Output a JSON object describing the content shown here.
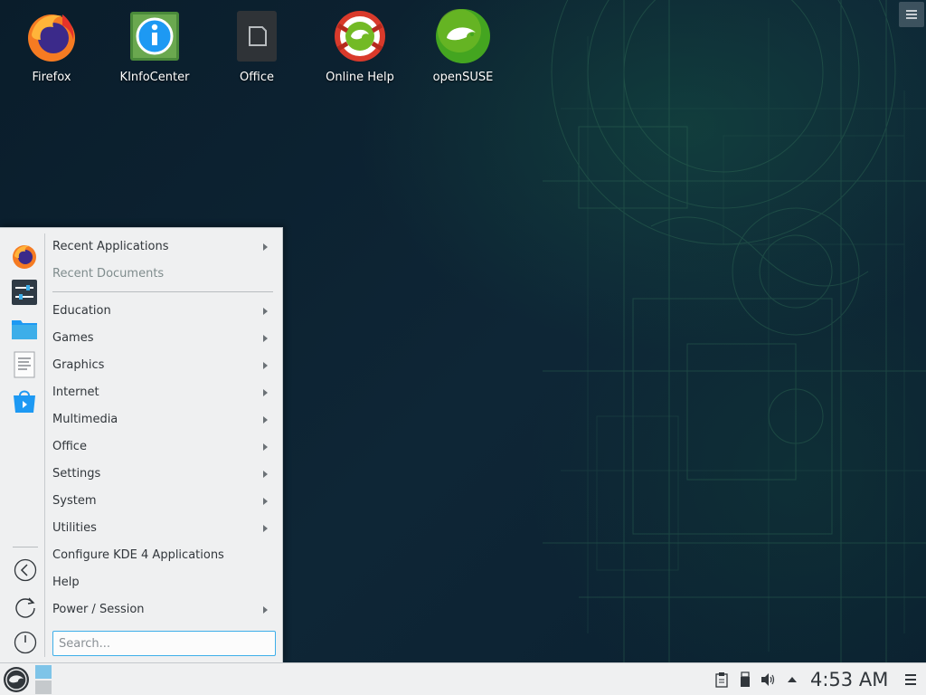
{
  "desktop": {
    "icons": [
      {
        "label": "Firefox",
        "icon": "firefox-icon"
      },
      {
        "label": "KInfoCenter",
        "icon": "kinfocenter-icon"
      },
      {
        "label": "Office",
        "icon": "office-icon"
      },
      {
        "label": "Online Help",
        "icon": "online-help-icon"
      },
      {
        "label": "openSUSE",
        "icon": "opensuse-icon"
      }
    ]
  },
  "menu": {
    "favorites": [
      {
        "icon": "firefox-icon"
      },
      {
        "icon": "system-settings-icon"
      },
      {
        "icon": "folder-icon"
      },
      {
        "icon": "text-editor-icon"
      },
      {
        "icon": "software-center-icon"
      }
    ],
    "controls": [
      {
        "icon": "back-icon"
      },
      {
        "icon": "refresh-icon"
      },
      {
        "icon": "power-icon"
      }
    ],
    "items": [
      {
        "label": "Recent Applications",
        "submenu": true
      },
      {
        "label": "Recent Documents",
        "submenu": false,
        "disabled": true
      },
      {
        "label": "Education",
        "submenu": true
      },
      {
        "label": "Games",
        "submenu": true
      },
      {
        "label": "Graphics",
        "submenu": true
      },
      {
        "label": "Internet",
        "submenu": true
      },
      {
        "label": "Multimedia",
        "submenu": true
      },
      {
        "label": "Office",
        "submenu": true
      },
      {
        "label": "Settings",
        "submenu": true
      },
      {
        "label": "System",
        "submenu": true
      },
      {
        "label": "Utilities",
        "submenu": true
      },
      {
        "label": "Configure KDE 4 Applications",
        "submenu": false
      },
      {
        "label": "Help",
        "submenu": false
      },
      {
        "label": "Power / Session",
        "submenu": true
      }
    ],
    "search": {
      "placeholder": "Search..."
    }
  },
  "panel": {
    "clock": "4:53 AM",
    "tray": [
      {
        "icon": "clipboard-icon"
      },
      {
        "icon": "removable-device-icon"
      },
      {
        "icon": "volume-icon"
      },
      {
        "icon": "expand-tray-arrow-icon"
      }
    ]
  },
  "colors": {
    "accent": "#3daee9",
    "panel_bg": "#eff0f1",
    "text": "#31363b",
    "desktop_bg": "#0d2231"
  }
}
